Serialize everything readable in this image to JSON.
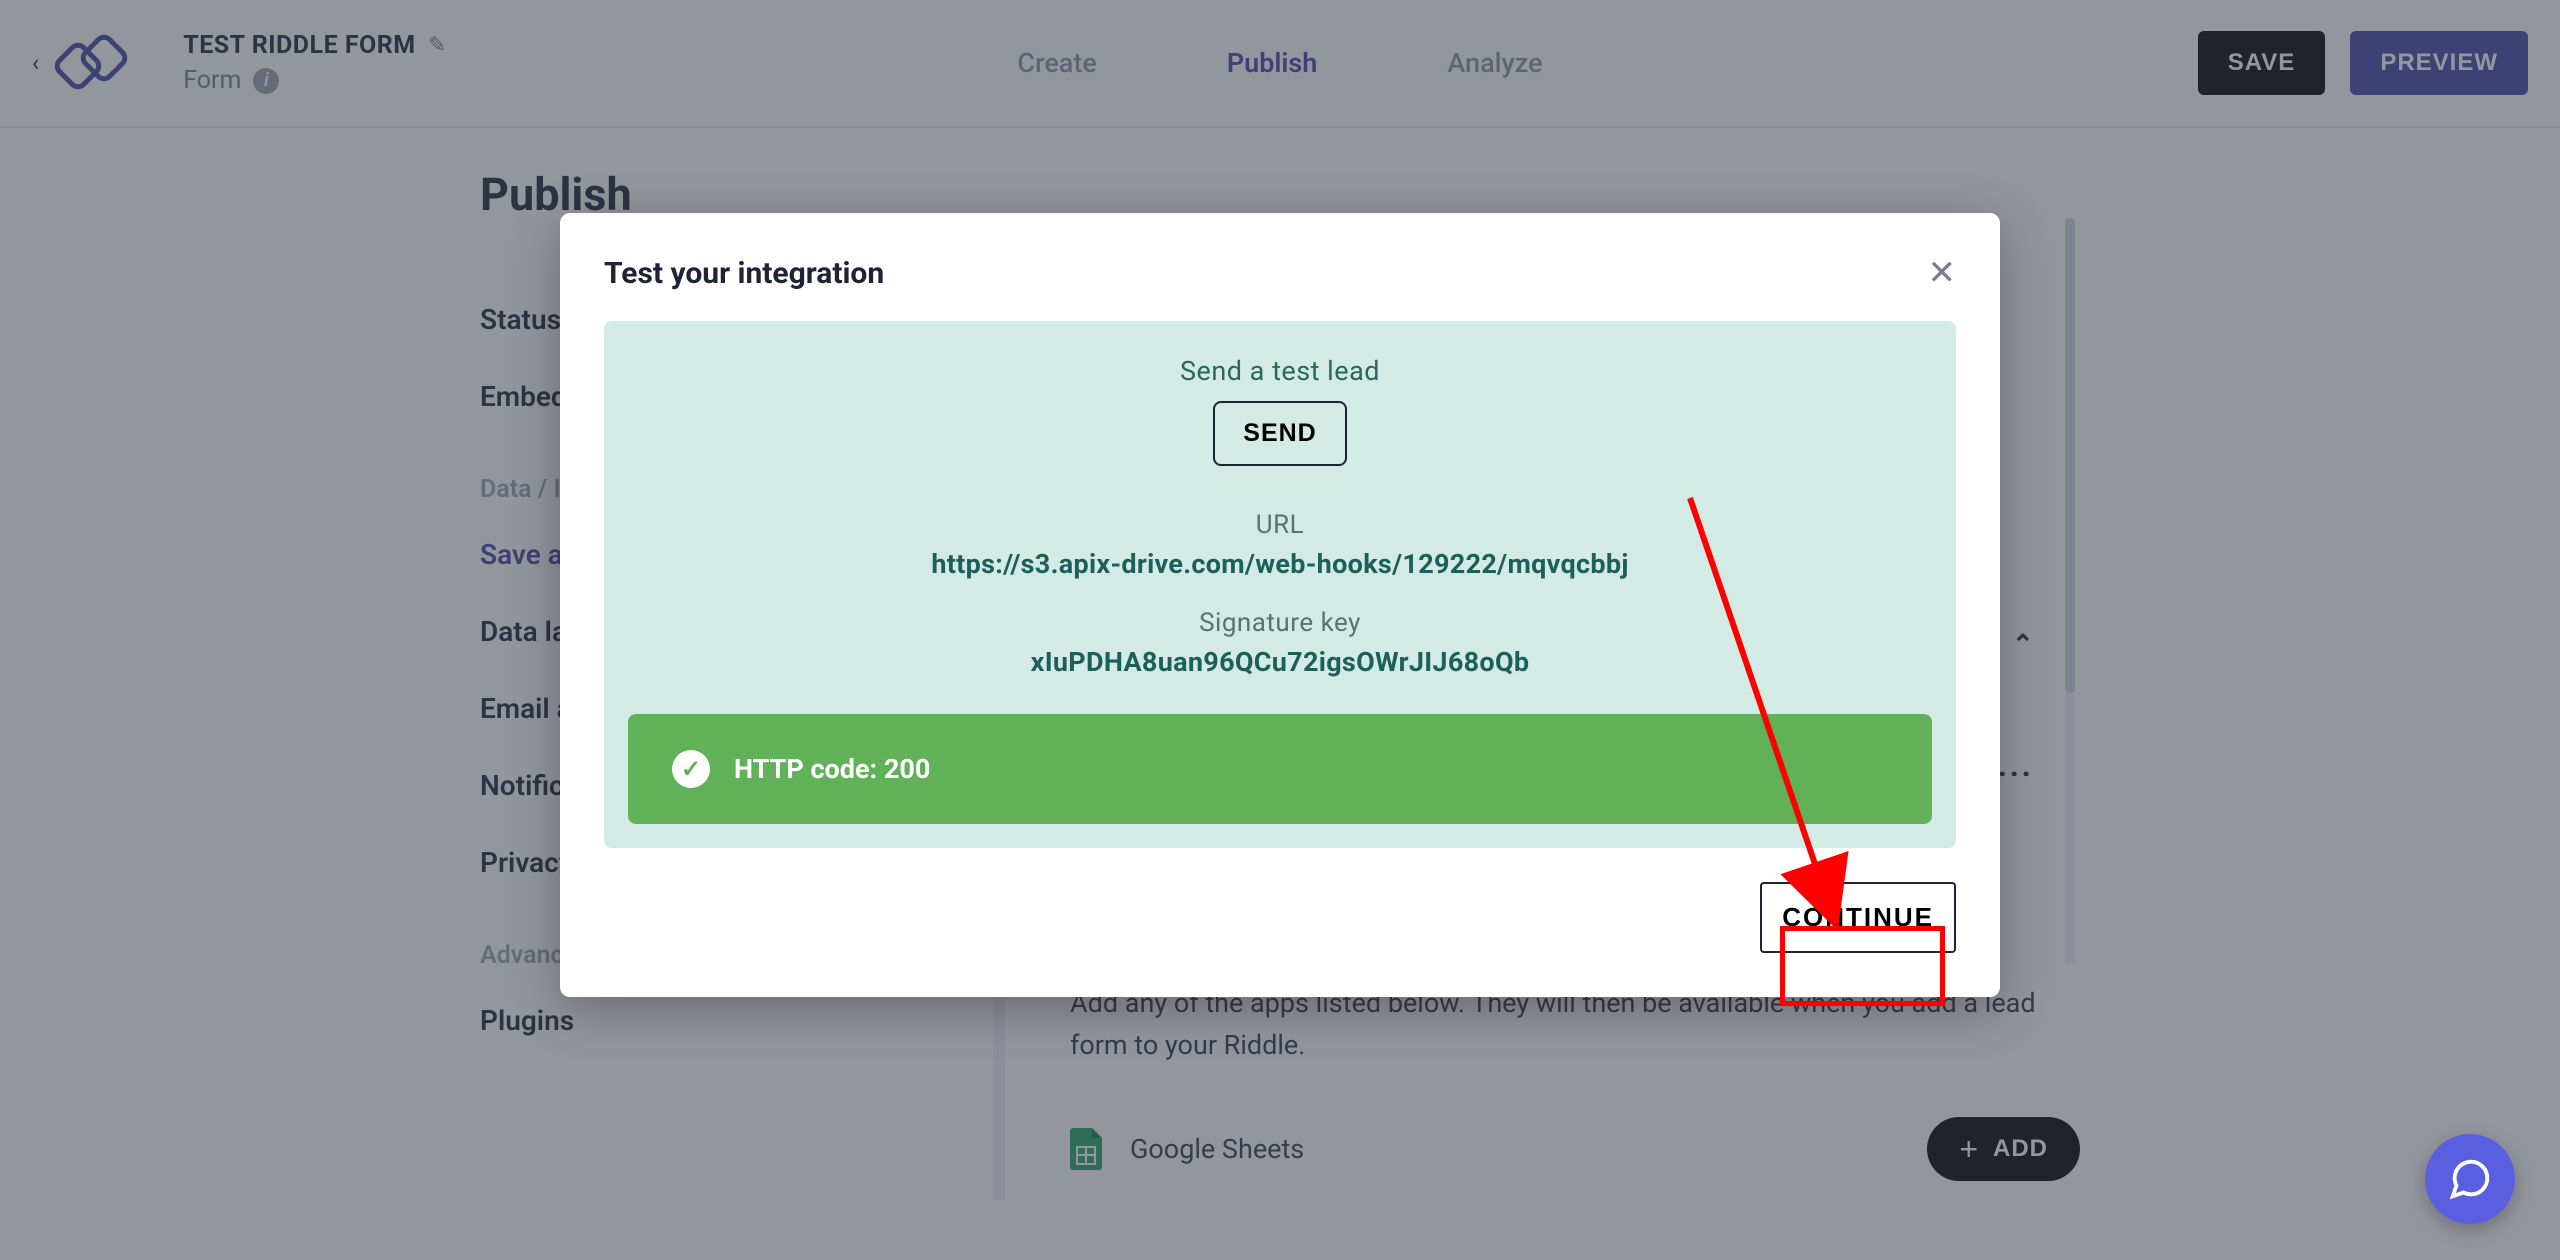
{
  "header": {
    "title": "TEST RIDDLE FORM",
    "subtitle": "Form",
    "tabs": {
      "create": "Create",
      "publish": "Publish",
      "analyze": "Analyze"
    },
    "save": "SAVE",
    "preview": "PREVIEW"
  },
  "sidebar": {
    "heading": "Publish",
    "items": {
      "status": "Status",
      "embed": "Embed",
      "data_section": "Data / Integrations",
      "save_and": "Save and send leads",
      "data_layer": "Data layer",
      "email_a": "Email addresses",
      "notific": "Notifications",
      "privacy": "Privacy",
      "advanced_section": "Advanced",
      "plugins": "Plugins"
    }
  },
  "content": {
    "desc": "Add any of the apps listed below. They will then be available when you add a lead form to your Riddle.",
    "integration": "Google Sheets",
    "add": "ADD"
  },
  "modal": {
    "title": "Test your integration",
    "test_label": "Send a test lead",
    "send": "SEND",
    "url_label": "URL",
    "url_value": "https://s3.apix-drive.com/web-hooks/129222/mqvqcbbj",
    "sig_label": "Signature key",
    "sig_value": "xIuPDHA8uan96QCu72igsOWrJIJ68oQb",
    "status": "HTTP code: 200",
    "continue": "CONTINUE"
  }
}
